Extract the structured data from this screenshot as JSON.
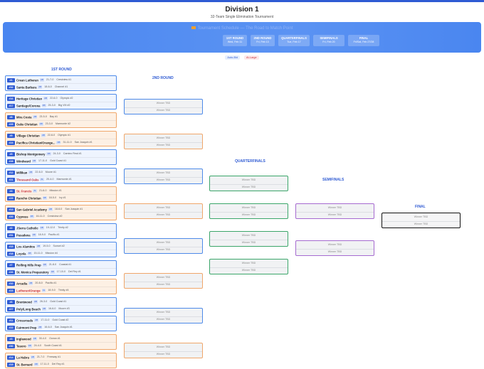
{
  "header": {
    "title": "Division 1",
    "subtitle": "32-Team Single Elimination Tournament"
  },
  "banner": {
    "message": "Tournament Schedule — The Road to Match Point"
  },
  "rounds": [
    {
      "name": "1ST ROUND",
      "date": "Wed, Feb 11"
    },
    {
      "name": "2ND ROUND",
      "date": "Fri, Feb 13"
    },
    {
      "name": "QUARTERFINALS",
      "date": "Tue, Feb 17"
    },
    {
      "name": "SEMIFINALS",
      "date": "Fri, Feb 20"
    },
    {
      "name": "FINAL",
      "date": "Fri/Sat, Feb 27/28"
    }
  ],
  "legend": {
    "auto": "Auto-Bid",
    "atlarge": "At-Large"
  },
  "labels": {
    "r1": "1ST ROUND",
    "r2": "2ND ROUND",
    "qf": "QUARTERFINALS",
    "sf": "SEMIFINALS",
    "final": "FINAL",
    "winner": "Winner TBD"
  },
  "matches": [
    {
      "color": "blue",
      "t": [
        {
          "seed": "#1",
          "name": "Crean Lutheran",
          "b1": "AB",
          "b2": "",
          "rec": "21-7-0",
          "conf": "Crestview #1"
        },
        {
          "seed": "#32",
          "name": "Santa Barbara",
          "b1": "AB",
          "b2": "",
          "rec": "18-6-0",
          "conf": "Channel #1"
        }
      ]
    },
    {
      "color": "blue",
      "t": [
        {
          "seed": "#16",
          "name": "Heritage Christian",
          "b1": "AB",
          "b2": "",
          "rec": "22-6-0",
          "conf": "Olympic #2"
        },
        {
          "seed": "#17",
          "name": "Santiago/Corona",
          "b1": "AB",
          "b2": "",
          "rec": "25-3-0",
          "conf": "Big VIII #2"
        }
      ]
    },
    {
      "color": "orange",
      "t": [
        {
          "seed": "#8",
          "name": "Mira Costa",
          "b1": "AB",
          "b2": "",
          "rec": "23-5-0",
          "conf": "Bay #1"
        },
        {
          "seed": "#25",
          "name": "Oaks Christian",
          "b1": "AB",
          "b2": "",
          "rec": "23-3-0",
          "conf": "Marmonte #2"
        }
      ]
    },
    {
      "color": "orange",
      "t": [
        {
          "seed": "#9",
          "name": "Village Christian",
          "b1": "AB",
          "b2": "",
          "rec": "22-6-0",
          "conf": "Olympic #1"
        },
        {
          "seed": "#24",
          "name": "Pacifica Christian/Orange...",
          "b1": "AB",
          "b2": "",
          "rec": "31-11-0",
          "conf": "San Joaquin #1"
        }
      ]
    },
    {
      "color": "blue",
      "t": [
        {
          "seed": "#5",
          "name": "Bishop Montgomery",
          "b1": "AB",
          "b2": "",
          "rec": "24-3-0",
          "conf": "Camino Real #1"
        },
        {
          "seed": "#28",
          "name": "Windward",
          "b1": "AB",
          "b2": "",
          "rec": "17-11-0",
          "conf": "Gold Coast #1"
        }
      ]
    },
    {
      "color": "blue",
      "t": [
        {
          "seed": "#12",
          "name": "Millikan",
          "b1": "AB",
          "b2": "",
          "rec": "22-6-0",
          "conf": "Moore #1"
        },
        {
          "seed": "#21",
          "name": "Thousand Oaks",
          "b1": "AL",
          "b2": "",
          "rec": "20-4-0",
          "conf": "Marmonte #1",
          "red": true
        }
      ]
    },
    {
      "color": "orange",
      "t": [
        {
          "seed": "#4",
          "name": "St. Francis",
          "b1": "AL",
          "b2": "",
          "rec": "21-6-0",
          "conf": "Mission #1",
          "red": true
        },
        {
          "seed": "#29",
          "name": "Rancho Christian",
          "b1": "AB",
          "b2": "",
          "rec": "18-5-0",
          "conf": "Ivy #1"
        }
      ]
    },
    {
      "color": "orange",
      "t": [
        {
          "seed": "#13",
          "name": "San Gabriel Academy",
          "b1": "AB",
          "b2": "",
          "rec": "18-6-0",
          "conf": "San Joaquin #1"
        },
        {
          "seed": "#20",
          "name": "Cypress",
          "b1": "AB",
          "b2": "",
          "rec": "16-11-0",
          "conf": "Crestview #2"
        }
      ]
    },
    {
      "color": "blue",
      "t": [
        {
          "seed": "#2",
          "name": "JSerra Catholic",
          "b1": "AB",
          "b2": "",
          "rec": "19-12-0",
          "conf": "Trinity #2"
        },
        {
          "seed": "#31",
          "name": "Pasadena",
          "b1": "AB",
          "b2": "",
          "rec": "18-9-0",
          "conf": "Pacific #1"
        }
      ]
    },
    {
      "color": "blue",
      "t": [
        {
          "seed": "#15",
          "name": "Los Alamitos",
          "b1": "AB",
          "b2": "",
          "rec": "19-5-0",
          "conf": "Sunset #2"
        },
        {
          "seed": "#18",
          "name": "Loyola",
          "b1": "AB",
          "b2": "",
          "rec": "15-11-0",
          "conf": "Mission #4"
        }
      ]
    },
    {
      "color": "blue",
      "t": [
        {
          "seed": "#7",
          "name": "Rolling Hills Prep",
          "b1": "AB",
          "b2": "",
          "rec": "21-8-0",
          "conf": "Coastal #1"
        },
        {
          "seed": "#26",
          "name": "St. Monica Preparatory",
          "b1": "AB",
          "b2": "",
          "rec": "17-10-0",
          "conf": "Del Rey #1"
        }
      ]
    },
    {
      "color": "orange",
      "t": [
        {
          "seed": "#10",
          "name": "Arcadia",
          "b1": "AB",
          "b2": "",
          "rec": "20-8-0",
          "conf": "Pacific #1"
        },
        {
          "seed": "#23",
          "name": "Lutheran/Orange",
          "b1": "AL",
          "b2": "",
          "rec": "18-9-0",
          "conf": "Trinity #4",
          "red": true
        }
      ]
    },
    {
      "color": "blue",
      "t": [
        {
          "seed": "#6",
          "name": "Brentwood",
          "b1": "AB",
          "b2": "",
          "rec": "26-3-0",
          "conf": "Gold Coast #1"
        },
        {
          "seed": "#27",
          "name": "Poly/Long Beach",
          "b1": "AB",
          "b2": "",
          "rec": "16-6-0",
          "conf": "Moore #3"
        }
      ]
    },
    {
      "color": "blue",
      "t": [
        {
          "seed": "#11",
          "name": "Crossroads",
          "b1": "AB",
          "b2": "",
          "rec": "17-11-0",
          "conf": "Gold Coast #2"
        },
        {
          "seed": "#22",
          "name": "Fairmont Prep",
          "b1": "AB",
          "b2": "",
          "rec": "16-6-0",
          "conf": "San Joaquin #1"
        }
      ]
    },
    {
      "color": "orange",
      "t": [
        {
          "seed": "#3",
          "name": "Inglewood",
          "b1": "AB",
          "b2": "",
          "rec": "30-4-0",
          "conf": "Ocean #1"
        },
        {
          "seed": "#30",
          "name": "Tesoro",
          "b1": "AB",
          "b2": "",
          "rec": "24-4-0",
          "conf": "South Coast #1"
        }
      ]
    },
    {
      "color": "orange",
      "t": [
        {
          "seed": "#14",
          "name": "La Habra",
          "b1": "AB",
          "b2": "",
          "rec": "21-7-0",
          "conf": "Freeway #1"
        },
        {
          "seed": "#19",
          "name": "St. Bernard",
          "b1": "AB",
          "b2": "",
          "rec": "17-11-0",
          "conf": "Del Rey #1"
        }
      ]
    }
  ]
}
